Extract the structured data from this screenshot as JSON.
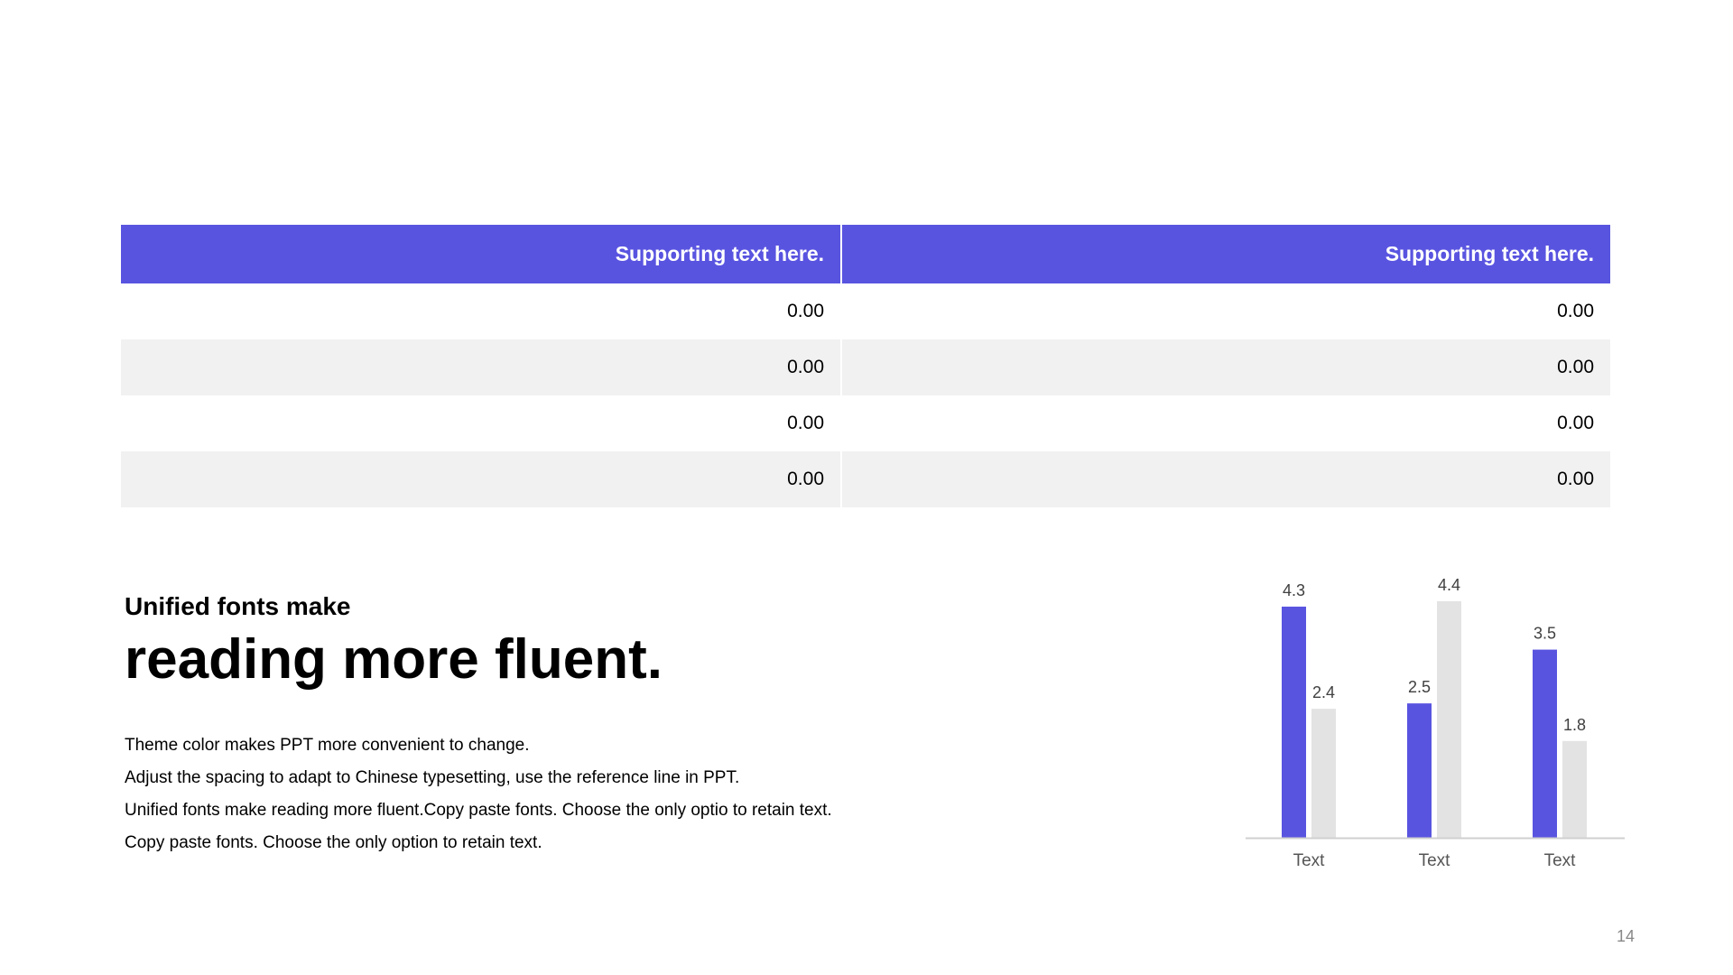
{
  "table": {
    "headers": [
      "Supporting text here.",
      "Supporting text here."
    ],
    "rows": [
      [
        "0.00",
        "0.00"
      ],
      [
        "0.00",
        "0.00"
      ],
      [
        "0.00",
        "0.00"
      ],
      [
        "0.00",
        "0.00"
      ]
    ]
  },
  "content": {
    "subtitle": "Unified fonts make",
    "headline": "reading more fluent.",
    "body": [
      "Theme color makes PPT more convenient  to change.",
      "Adjust the spacing to adapt to Chinese  typesetting, use the reference line  in PPT.",
      "Unified  fonts make reading more fluent.Copy paste fonts. Choose the only optio to retain text.",
      "Copy paste  fonts. Choose the only option to retain text."
    ]
  },
  "chart_data": {
    "type": "bar",
    "categories": [
      "Text",
      "Text",
      "Text"
    ],
    "series": [
      {
        "values": [
          4.3,
          2.5,
          3.5
        ],
        "color": "#5954e0"
      },
      {
        "values": [
          2.4,
          4.4,
          1.8
        ],
        "color": "#e3e3e3"
      }
    ],
    "ylim": [
      0,
      4.4
    ],
    "grid": false,
    "legend": "none",
    "data_labels": true
  },
  "page": {
    "number": "14"
  },
  "colors": {
    "accent": "#5954e0",
    "row_shade": "#f1f1f1",
    "secondary_bar": "#e3e3e3",
    "axis": "#d0d0d0"
  }
}
